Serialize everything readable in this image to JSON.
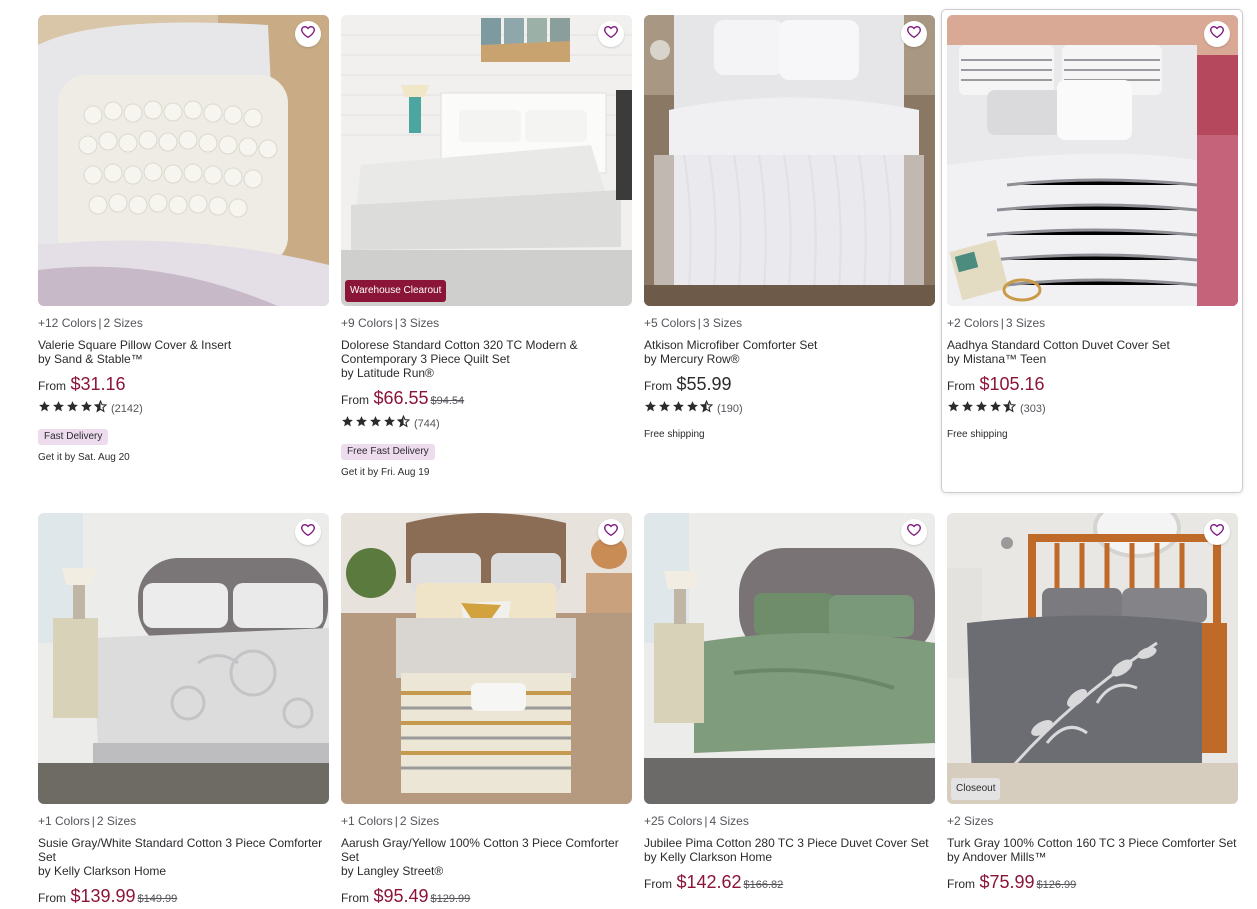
{
  "products": [
    {
      "meta_colors": "+12 Colors",
      "meta_sizes": "2 Sizes",
      "title": "Valerie Square Pillow Cover & Insert",
      "by": "by Sand & Stable™",
      "price_prefix": "From",
      "price": "$31.16",
      "price_was": "",
      "price_is_sale": true,
      "rating": 4.5,
      "review_count": "(2142)",
      "image_badge": "",
      "delivery_badge": "Fast Delivery",
      "delivery_date": "Get it by Sat. Aug 20",
      "shipping": ""
    },
    {
      "meta_colors": "+9 Colors",
      "meta_sizes": "3 Sizes",
      "title": "Dolorese Standard Cotton 320 TC Modern & Contemporary 3 Piece Quilt Set",
      "by": "by Latitude Run®",
      "price_prefix": "From",
      "price": "$66.55",
      "price_was": "$94.54",
      "price_is_sale": true,
      "rating": 4.5,
      "review_count": "(744)",
      "image_badge": "Warehouse Clearout",
      "delivery_badge": "Free Fast Delivery",
      "delivery_date": "Get it by Fri. Aug 19",
      "shipping": ""
    },
    {
      "meta_colors": "+5 Colors",
      "meta_sizes": "3 Sizes",
      "title": "Atkison Microfiber Comforter Set",
      "by": "by Mercury Row®",
      "price_prefix": "From",
      "price": "$55.99",
      "price_was": "",
      "price_is_sale": false,
      "rating": 4.5,
      "review_count": "(190)",
      "image_badge": "",
      "delivery_badge": "",
      "delivery_date": "",
      "shipping": "Free shipping"
    },
    {
      "meta_colors": "+2 Colors",
      "meta_sizes": "3 Sizes",
      "title": "Aadhya Standard Cotton Duvet Cover Set",
      "by": "by Mistana™ Teen",
      "price_prefix": "From",
      "price": "$105.16",
      "price_was": "",
      "price_is_sale": true,
      "rating": 4.5,
      "review_count": "(303)",
      "image_badge": "",
      "delivery_badge": "",
      "delivery_date": "",
      "shipping": "Free shipping"
    },
    {
      "meta_colors": "+1 Colors",
      "meta_sizes": "2 Sizes",
      "title": "Susie Gray/White Standard Cotton 3 Piece Comforter Set",
      "by": "by Kelly Clarkson Home",
      "price_prefix": "From",
      "price": "$139.99",
      "price_was": "$149.99",
      "price_is_sale": true,
      "image_badge": ""
    },
    {
      "meta_colors": "+1 Colors",
      "meta_sizes": "2 Sizes",
      "title": "Aarush Gray/Yellow 100% Cotton 3 Piece Comforter Set",
      "by": "by Langley Street®",
      "price_prefix": "From",
      "price": "$95.49",
      "price_was": "$129.99",
      "price_is_sale": true,
      "image_badge": ""
    },
    {
      "meta_colors": "+25 Colors",
      "meta_sizes": "4 Sizes",
      "title": "Jubilee Pima Cotton 280 TC 3 Piece Duvet Cover Set",
      "by": "by Kelly Clarkson Home",
      "price_prefix": "From",
      "price": "$142.62",
      "price_was": "$166.82",
      "price_is_sale": true,
      "image_badge": ""
    },
    {
      "meta_colors": "+2 Sizes",
      "meta_sizes": "",
      "title": "Turk Gray 100% Cotton 160 TC 3 Piece Comforter Set",
      "by": "by Andover Mills™",
      "price_prefix": "From",
      "price": "$75.99",
      "price_was": "$126.99",
      "price_is_sale": true,
      "image_badge": "Closeout"
    }
  ],
  "colors": {
    "sale_price": "#8b1538",
    "badge_clearout": "#8b1538",
    "delivery_pill": "#ecdcee",
    "heart": "#7f187f",
    "star": "#2d2a2e"
  },
  "icons": {
    "favorite": "heart-outline-icon",
    "rating": "star-icon"
  }
}
